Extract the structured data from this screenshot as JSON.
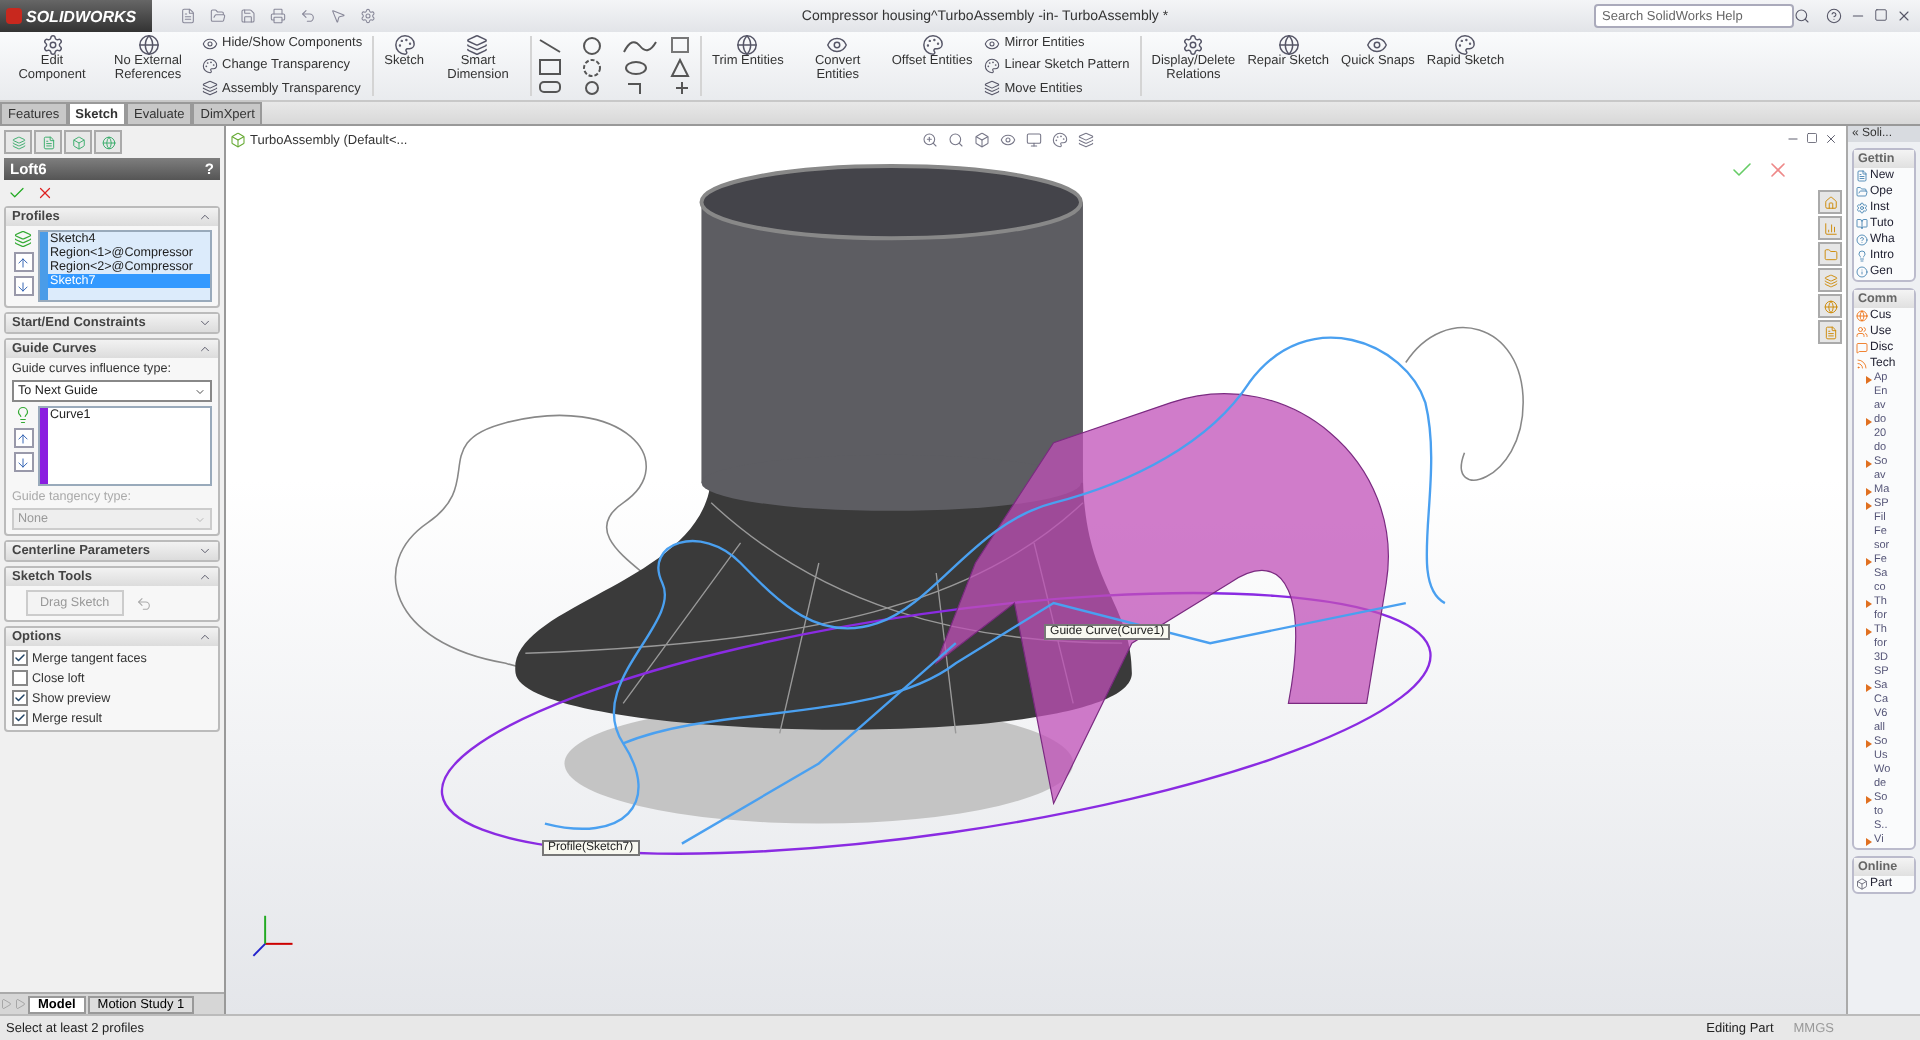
{
  "title_bar": {
    "app": "SOLIDWORKS",
    "title": "Compressor housing^TurboAssembly -in- TurboAssembly *",
    "search": {
      "placeholder": "Search SolidWorks Help"
    }
  },
  "ribbon": [
    {
      "kind": "large",
      "label": "Edit Component"
    },
    {
      "kind": "large",
      "label": "No External References"
    },
    {
      "kind": "stack",
      "items": [
        "Hide/Show Components",
        "Change Transparency",
        "Assembly Transparency"
      ]
    },
    {
      "kind": "large",
      "label": "Sketch"
    },
    {
      "kind": "large",
      "label": "Smart Dimension"
    },
    {
      "kind": "sketch_tools"
    },
    {
      "kind": "large",
      "label": "Trim Entities"
    },
    {
      "kind": "large",
      "label": "Convert Entities"
    },
    {
      "kind": "large",
      "label": "Offset Entities"
    },
    {
      "kind": "stack",
      "items": [
        "Mirror Entities",
        "Linear Sketch Pattern",
        "Move Entities"
      ]
    },
    {
      "kind": "large",
      "label": "Display/Delete Relations"
    },
    {
      "kind": "large",
      "label": "Repair Sketch"
    },
    {
      "kind": "large",
      "label": "Quick Snaps"
    },
    {
      "kind": "large",
      "label": "Rapid Sketch"
    }
  ],
  "command_tabs": [
    {
      "label": "Features",
      "selected": false
    },
    {
      "label": "Sketch",
      "selected": true
    },
    {
      "label": "Evaluate",
      "selected": false
    },
    {
      "label": "DimXpert",
      "selected": false
    }
  ],
  "property_manager": {
    "title": "Loft6",
    "help": "?",
    "sections": [
      {
        "kind": "profiles",
        "title": "Profiles",
        "expanded": true,
        "items": [
          {
            "label": "Sketch4",
            "selected": false
          },
          {
            "label": "Region<1>@Compressor",
            "selected": false
          },
          {
            "label": "Region<2>@Compressor",
            "selected": false
          },
          {
            "label": "Sketch7",
            "selected": true
          }
        ]
      },
      {
        "kind": "header",
        "title": "Start/End Constraints",
        "expanded": false
      },
      {
        "kind": "guides",
        "title": "Guide Curves",
        "expanded": true,
        "influence_label": "Guide curves influence type:",
        "influence_value": "To Next Guide",
        "items": [
          {
            "label": "Curve1",
            "selected": false
          }
        ],
        "tangency_label": "Guide tangency type:",
        "tangency_value": "None",
        "tangency_disabled": true
      },
      {
        "kind": "header",
        "title": "Centerline Parameters",
        "expanded": false
      },
      {
        "kind": "tools",
        "title": "Sketch Tools",
        "expanded": true,
        "button": "Drag Sketch",
        "button_disabled": true
      },
      {
        "kind": "options",
        "title": "Options",
        "expanded": true,
        "options": [
          {
            "label": "Merge tangent faces",
            "checked": true
          },
          {
            "label": "Close loft",
            "checked": false
          },
          {
            "label": "Show preview",
            "checked": true
          },
          {
            "label": "Merge result",
            "checked": true
          }
        ]
      }
    ]
  },
  "tree": {
    "root": "TurboAssembly (Default<..."
  },
  "viewport": {
    "callouts": [
      {
        "label": "Guide Curve(Curve1)"
      },
      {
        "label": "Profile(Sketch7)"
      }
    ]
  },
  "task_pane": {
    "title": "« Soli...",
    "getting_started": {
      "title": "Gettin",
      "items": [
        "New",
        "Ope",
        "Inst",
        "Tuto",
        "Wha",
        "Intro",
        "Gen"
      ]
    },
    "community": {
      "title": "Comm",
      "items": [
        "Cus",
        "Use",
        "Disc",
        "Tech"
      ],
      "feed": [
        [
          "Ap",
          "En",
          "av"
        ],
        [
          "do",
          "20",
          "do"
        ],
        [
          "So",
          "av"
        ],
        [
          "Ma"
        ],
        [
          "SP",
          "Fil",
          "Fe",
          "sor"
        ],
        [
          "Fe",
          "Sa",
          "co"
        ],
        [
          "Th",
          "for"
        ],
        [
          "Th",
          "for",
          "3D",
          "SP"
        ],
        [
          "Sa",
          "Ca",
          "V6",
          "all"
        ],
        [
          "So",
          "Us",
          "Wo",
          "de"
        ],
        [
          "So",
          "to",
          "S.."
        ],
        [
          "Vi"
        ]
      ]
    },
    "online": {
      "title": "Online",
      "items": [
        "Part"
      ]
    }
  },
  "bottom_tabs": [
    {
      "label": "Model",
      "selected": true
    },
    {
      "label": "Motion Study 1",
      "selected": false
    }
  ],
  "status_bar": {
    "message": "Select at least 2 profiles",
    "mode": "Editing Part",
    "units": "MMGS"
  }
}
